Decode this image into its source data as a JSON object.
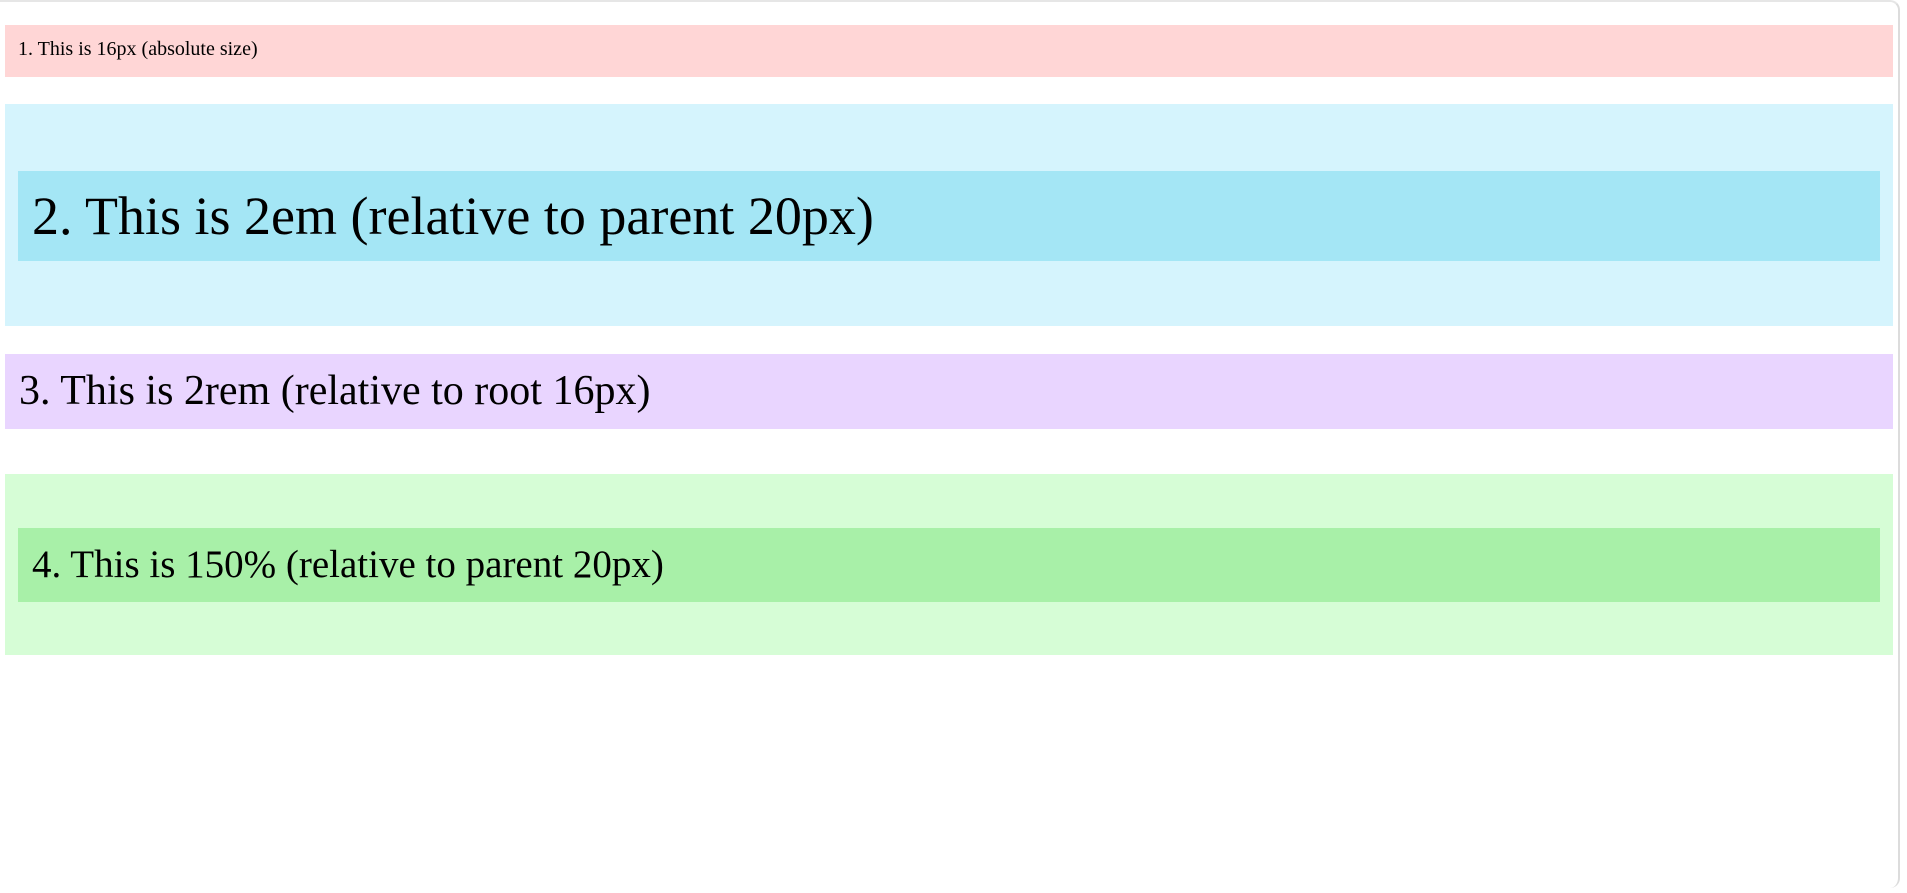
{
  "examples": {
    "absolute": "1. This is 16px (absolute size)",
    "em": "2. This is 2em (relative to parent 20px)",
    "rem": "3. This is 2rem (relative to root 16px)",
    "percent": "4. This is 150% (relative to parent 20px)"
  },
  "colors": {
    "absolute_bg": "#ffd6d6",
    "em_outer_bg": "#d5f4fd",
    "em_inner_bg": "#a4e6f5",
    "rem_bg": "#e9d5ff",
    "percent_outer_bg": "#d6fdd6",
    "percent_inner_bg": "#a8f0a8"
  }
}
